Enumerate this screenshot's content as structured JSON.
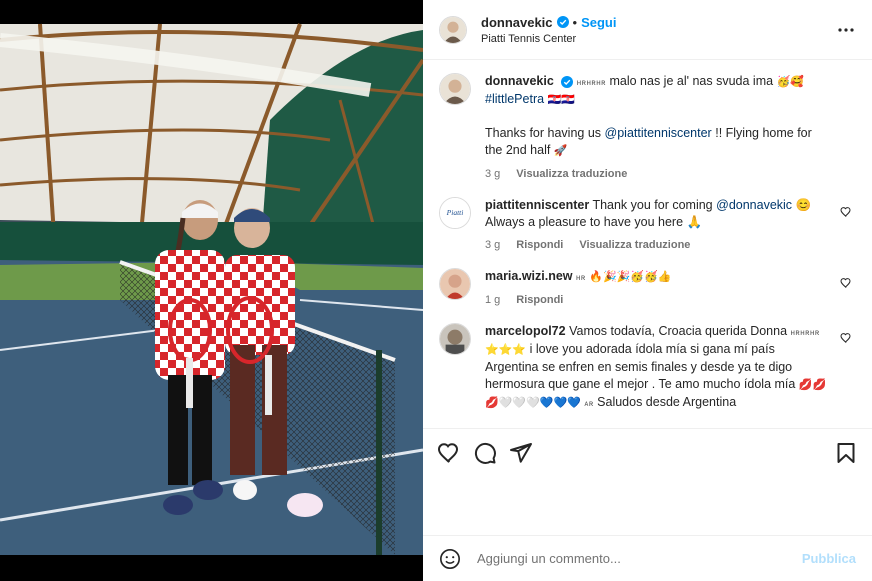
{
  "post": {
    "username": "donnavekic",
    "follow_label": "Segui",
    "location": "Piatti Tennis Center",
    "more_icon": "more-horizontal-icon"
  },
  "caption": {
    "username": "donnavekic",
    "line1_tag": "ʜʀʜʀʜʀ",
    "line1_text": "malo nas je al' nas svuda ima",
    "line1_emoji": "🥳🥰",
    "hashtag": "#littlePetra",
    "hashtag_emoji": "🇭🇷🇭🇷",
    "line2_pre": "Thanks for having us",
    "line2_mention": "@piattitenniscenter",
    "line2_post": "!! Flying home for the 2nd half",
    "line2_emoji": "🚀",
    "time": "3 g",
    "translate": "Visualizza traduzione"
  },
  "comments": [
    {
      "username": "piattitenniscenter",
      "text_pre": "Thank you for coming",
      "mention": "@donnavekic",
      "text_post": "😊 Always a pleasure to have you here 🙏",
      "time": "3 g",
      "reply": "Rispondi",
      "translate": "Visualizza traduzione",
      "avatar_text": "Piatti"
    },
    {
      "username": "maria.wizi.new",
      "tag": "ʜʀ",
      "text": "🔥🎉🎉🥳🥳👍",
      "time": "1 g",
      "reply": "Rispondi"
    },
    {
      "username": "marcelopol72",
      "text1": "Vamos todavía, Croacia querida Donna",
      "tag": "ʜʀʜʀʜʀ",
      "stars": "⭐⭐⭐",
      "text2": "i love you adorada ídola mía si gana mí país Argentina se enfren en semis finales y desde ya te digo hermosura que gane el mejor . Te amo mucho ídola mía",
      "emoji1": "💋💋",
      "emoji2": "💋🤍🤍🤍💙💙💙",
      "tag2": "ᴀʀ",
      "text3": "Saludos desde Argentina"
    }
  ],
  "add_comment": {
    "placeholder": "Aggiungi un commento...",
    "publish_label": "Pubblica"
  },
  "colors": {
    "accent": "#0095f6",
    "link": "#00376b",
    "muted": "#737373",
    "publish_disabled": "#b2dffc"
  }
}
